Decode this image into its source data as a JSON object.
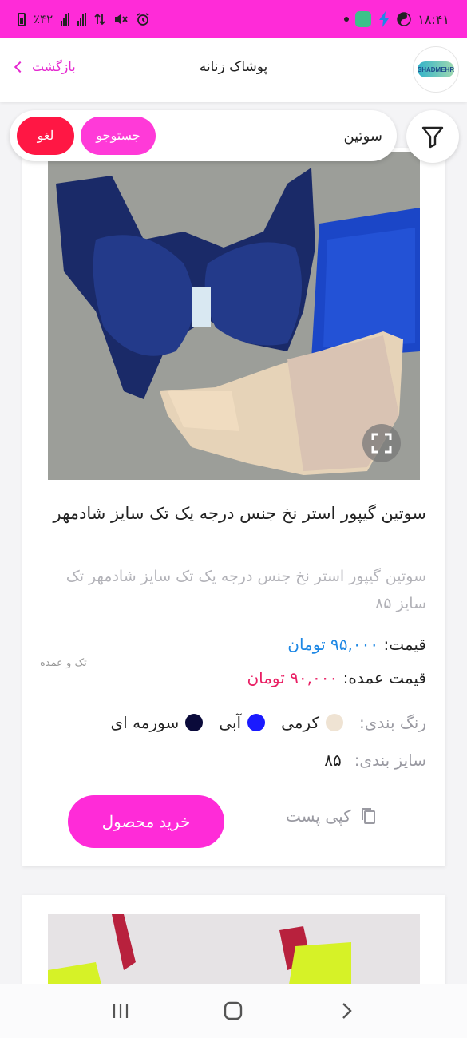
{
  "status_bar": {
    "time": "۱۸:۴۱",
    "battery": "٪۴۲"
  },
  "header": {
    "title": "پوشاک زنانه",
    "back_label": "بازگشت"
  },
  "search": {
    "value": "سوتین",
    "search_label": "جستوجو",
    "cancel_label": "لغو"
  },
  "product": {
    "title": "سوتین گیپور استر نخ جنس درجه یک تک سایز شادمهر",
    "description": "سوتین گیپور استر نخ جنس درجه یک تک سایز شادمهر تک سایز ۸۵",
    "price_label": "قیمت:",
    "price_value": "۹۵,۰۰۰ تومان",
    "wholesale_label": "قیمت عمده:",
    "wholesale_value": "۹۰,۰۰۰ تومان",
    "sale_type": "تک و عمده",
    "colors_label": "رنگ بندی:",
    "colors": [
      {
        "name": "کرمی",
        "hex": "#efe3d3"
      },
      {
        "name": "آبی",
        "hex": "#1a1aff"
      },
      {
        "name": "سورمه ای",
        "hex": "#0a0a3a"
      }
    ],
    "size_label": "سایز بندی:",
    "size_value": "۸۵",
    "copy_label": "کپی پست",
    "buy_label": "خرید محصول"
  },
  "colors": {
    "accent": "#ff2bd8",
    "cancel": "#ff1744",
    "price": "#1e88e5",
    "wholesale": "#e91e63"
  }
}
